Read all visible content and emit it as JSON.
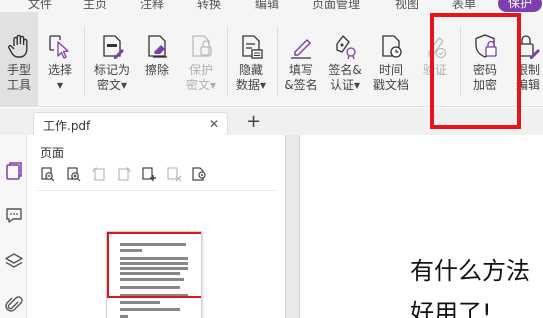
{
  "menu": {
    "items": [
      "文件",
      "主页",
      "注释",
      "转换",
      "编辑",
      "页面管理",
      "视图",
      "表单",
      "保护"
    ],
    "active": "保护"
  },
  "ribbon": {
    "hand_tool": "手型\n工具",
    "select": "选择\n▾",
    "mark_redact": "标记为\n密文▾",
    "erase": "擦除",
    "protect_redact": "保护\n密文▾",
    "hide_data": "隐藏\n数据▾",
    "fill_sign": "填写\n&签名",
    "sign_cert": "签名&\n认证▾",
    "timestamp": "时间\n戳文档",
    "verify": "验证",
    "password_encrypt": "密码\n加密",
    "restrict_edit": "限制\n编辑"
  },
  "tabs": {
    "doc_name": "工作.pdf",
    "close": "✕",
    "new": "+"
  },
  "panel": {
    "title": "页面"
  },
  "document": {
    "line1": "有什么方法",
    "line2": "好用了!"
  },
  "colors": {
    "accent_purple": "#7b3fb0",
    "highlight_red": "#e8141c",
    "thumb_select_red": "#d9161c"
  },
  "icons": [
    "hand-icon",
    "select-cursor-icon",
    "redact-mark-icon",
    "eraser-icon",
    "protect-redact-icon",
    "hide-data-icon",
    "fill-sign-icon",
    "sign-certify-icon",
    "timestamp-icon",
    "verify-icon",
    "password-lock-icon",
    "restrict-edit-icon"
  ]
}
